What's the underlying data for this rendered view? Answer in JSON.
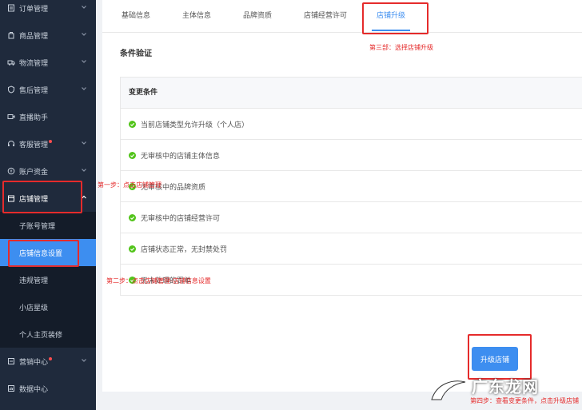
{
  "sidebar": {
    "items": [
      {
        "label": "订单管理",
        "icon": "order-icon"
      },
      {
        "label": "商品管理",
        "icon": "goods-icon"
      },
      {
        "label": "物流管理",
        "icon": "truck-icon"
      },
      {
        "label": "售后管理",
        "icon": "shield-icon"
      },
      {
        "label": "直播助手",
        "icon": "video-icon"
      },
      {
        "label": "客服管理",
        "icon": "headset-icon"
      },
      {
        "label": "账户资金",
        "icon": "coin-icon"
      },
      {
        "label": "店铺管理",
        "icon": "store-icon"
      }
    ],
    "sub_items": [
      {
        "label": "子账号管理"
      },
      {
        "label": "店铺信息设置"
      },
      {
        "label": "违规管理"
      },
      {
        "label": "小店星级"
      },
      {
        "label": "个人主页装修"
      }
    ],
    "bottom_items": [
      {
        "label": "营销中心",
        "icon": "marketing-icon"
      },
      {
        "label": "数据中心",
        "icon": "data-icon"
      }
    ]
  },
  "tabs": [
    "基础信息",
    "主体信息",
    "品牌资质",
    "店铺经营许可",
    "店铺升级"
  ],
  "section_title": "条件验证",
  "conditions": {
    "header": "变更条件",
    "rows": [
      "当前店铺类型允许升级（个人店）",
      "无审核中的店铺主体信息",
      "无审核中的品牌资质",
      "无审核中的店铺经营许可",
      "店铺状态正常，无封禁处罚",
      "无未处理的罚单"
    ]
  },
  "upgrade_button": "升级店铺",
  "annotations": {
    "step1": "第一步：点击店铺管理",
    "step2": "第二步：点击店铺管理-店铺信息设置",
    "step3": "第三部：选择店铺升级",
    "step4": "第四步：查看变更条件，点击升级店铺"
  },
  "watermark": "广东龙网",
  "colors": {
    "sidebar_bg": "#1f2a3c",
    "accent": "#3d8ef0",
    "annotation": "#e52b2b",
    "check": "#52c41a"
  }
}
